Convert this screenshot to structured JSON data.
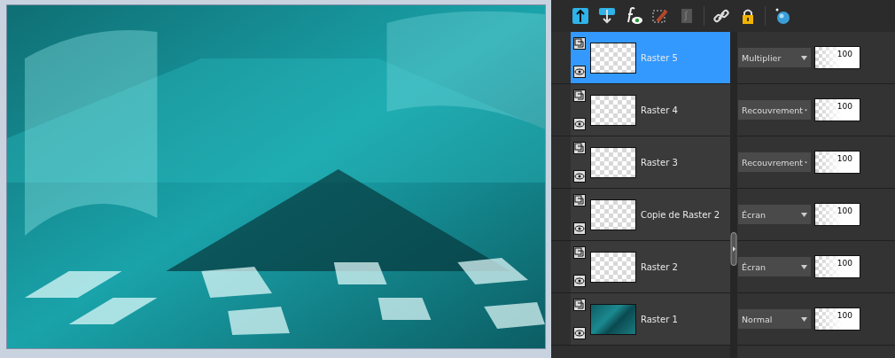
{
  "layers": [
    {
      "name": "Raster 5",
      "selected": true,
      "kind": "transparent",
      "blend_mode": "Multiplier",
      "opacity": "100"
    },
    {
      "name": "Raster 4",
      "selected": false,
      "kind": "transparent",
      "blend_mode": "Recouvrement",
      "opacity": "100"
    },
    {
      "name": "Raster 3",
      "selected": false,
      "kind": "transparent",
      "blend_mode": "Recouvrement",
      "opacity": "100"
    },
    {
      "name": "Copie de Raster 2",
      "selected": false,
      "kind": "transparent",
      "blend_mode": "Écran",
      "opacity": "100"
    },
    {
      "name": "Raster 2",
      "selected": false,
      "kind": "transparent",
      "blend_mode": "Écran",
      "opacity": "100"
    },
    {
      "name": "Raster 1",
      "selected": false,
      "kind": "image",
      "blend_mode": "Normal",
      "opacity": "100"
    }
  ]
}
